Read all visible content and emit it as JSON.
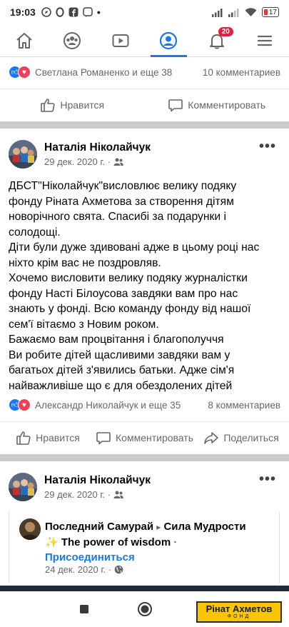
{
  "status_bar": {
    "time": "19:03",
    "battery": "17"
  },
  "nav": {
    "tabs": [
      {
        "name": "home-icon"
      },
      {
        "name": "groups-icon"
      },
      {
        "name": "watch-icon"
      },
      {
        "name": "profile-icon",
        "active": true
      },
      {
        "name": "notifications-icon",
        "badge": "20"
      },
      {
        "name": "menu-icon"
      }
    ]
  },
  "prev_post": {
    "reactions_text": "Светлана Романенко и еще 38",
    "comments": "10 комментариев",
    "like_label": "Нравится",
    "comment_label": "Комментировать"
  },
  "post1": {
    "author": "Наталія Ніколайчук",
    "date": "29 дек. 2020 г. ·",
    "text_lines": [
      "ДБСТ\"Ніколайчук\"висловлює велику подяку",
      "фонду Ріната Ахметова за створення дітям",
      "новорічного свята. Спасибі за подарунки і",
      "солодощі.",
      "Діти були дуже здивовані адже в цьому році нас",
      "ніхто крім вас не поздровляв.",
      "Хочемо висловити велику подяку журналістки",
      "фонду Насті Білоусова завдяки вам про нас",
      "знають у фонді. Всю команду фонду від нашої",
      "сем'ї вітаємо з Новим роком.",
      "Бажаємо вам процвітання і благополуччя",
      "Ви робите дітей щасливими завдяки вам у",
      "багатьох дітей з'явились батьки. Адже сім'я",
      "найважливіше що є для обездолених дітей"
    ],
    "reactions_text": "Александр Николайчук и еще 35",
    "comments": "8 комментариев",
    "like_label": "Нравится",
    "comment_label": "Комментировать",
    "share_label": "Поделиться"
  },
  "post2": {
    "author": "Наталія Ніколайчук",
    "date": "29 дек. 2020 г. ·",
    "shared": {
      "title_author": "Последний Самурай",
      "title_arrow": "▸",
      "title_group": "Сила Мудрости",
      "title_line2": "✨ The power of wisdom",
      "title_dot": "·",
      "join_label": "Присоединиться",
      "date": "24 дек. 2020 г. ·"
    }
  },
  "watermark": {
    "main": "Рінат Ахметов",
    "sub": "ФОНД"
  },
  "colors": {
    "accent": "#1877f2",
    "badge": "#e41e3f",
    "love": "#f33e58"
  }
}
